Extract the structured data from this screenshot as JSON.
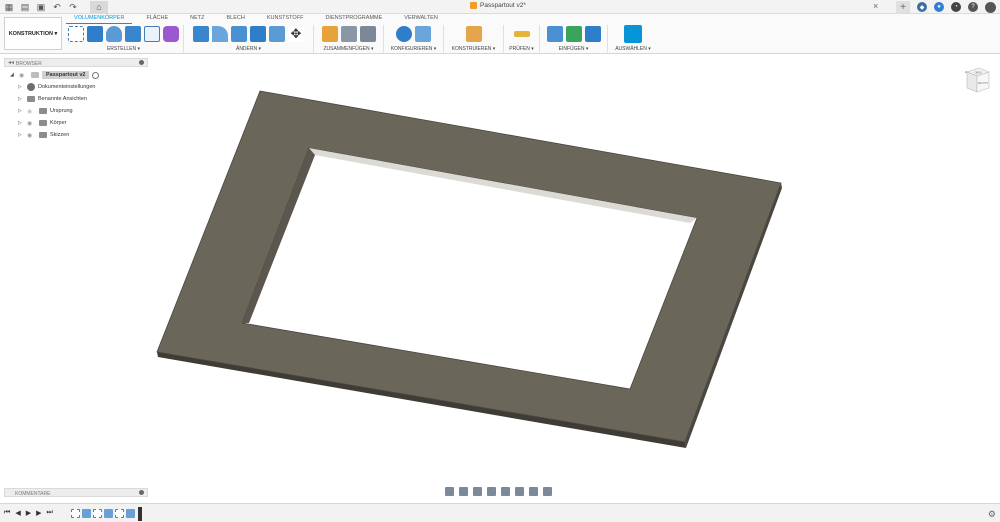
{
  "titlebar": {
    "document_title": "Passpartout v2*",
    "close_symbol": "×",
    "left_icons": [
      "grid-icon",
      "file-icon",
      "save-icon",
      "undo-icon",
      "redo-icon"
    ],
    "right_icons": [
      "plus-icon",
      "extensions-icon",
      "notifications-icon",
      "clock-icon",
      "help-icon",
      "user-avatar"
    ]
  },
  "ribbon": {
    "workspace": "KONSTRUKTION ▾",
    "tabs": [
      "VOLUMENKÖRPER",
      "FLÄCHE",
      "NETZ",
      "BLECH",
      "KUNSTSTOFF",
      "DIENSTPROGRAMME",
      "VERWALTEN"
    ],
    "groups": [
      {
        "label": "ERSTELLEN ▾",
        "icons": [
          "sketch-icon",
          "extrude-icon",
          "revolve-icon",
          "hole-icon",
          "pattern-icon",
          "form-icon"
        ]
      },
      {
        "label": "ÄNDERN ▾",
        "icons": [
          "press-pull-icon",
          "fillet-icon",
          "chamfer-icon",
          "shell-icon",
          "combine-icon",
          "move-icon"
        ]
      },
      {
        "label": "ZUSAMMENFÜGEN ▾",
        "icons": [
          "new-component-icon",
          "joint-icon",
          "as-built-joint-icon"
        ]
      },
      {
        "label": "KONFIGURIEREN ▾",
        "icons": [
          "configure-icon",
          "table-icon"
        ]
      },
      {
        "label": "KONSTRUIEREN ▾",
        "icons": [
          "plane-icon"
        ]
      },
      {
        "label": "PRÜFEN ▾",
        "icons": [
          "measure-icon"
        ]
      },
      {
        "label": "EINFÜGEN ▾",
        "icons": [
          "insert-derive-icon",
          "insert-mesh-icon",
          "insert-image-icon"
        ]
      },
      {
        "label": "AUSWÄHLEN ▾",
        "icons": [
          "select-icon"
        ]
      }
    ],
    "colors": {
      "accent": "#0696d7"
    }
  },
  "browser": {
    "title": "BROWSER",
    "root": "Passpartout v2",
    "items": [
      "Dokumenteinstellungen",
      "Benannte Ansichten",
      "Ursprung",
      "Körper",
      "Skizzen"
    ]
  },
  "viewcube": {
    "face_top": "OBEN",
    "face_front": "RECHTS"
  },
  "comments": {
    "title": "KOMMENTARE"
  },
  "timeline": {
    "controls": [
      "⏮",
      "◀",
      "▶",
      "▶",
      "⏭"
    ]
  },
  "model": {
    "name": "passepartout-frame",
    "face_color": "#6b665a",
    "edge_color": "#4a4740"
  }
}
